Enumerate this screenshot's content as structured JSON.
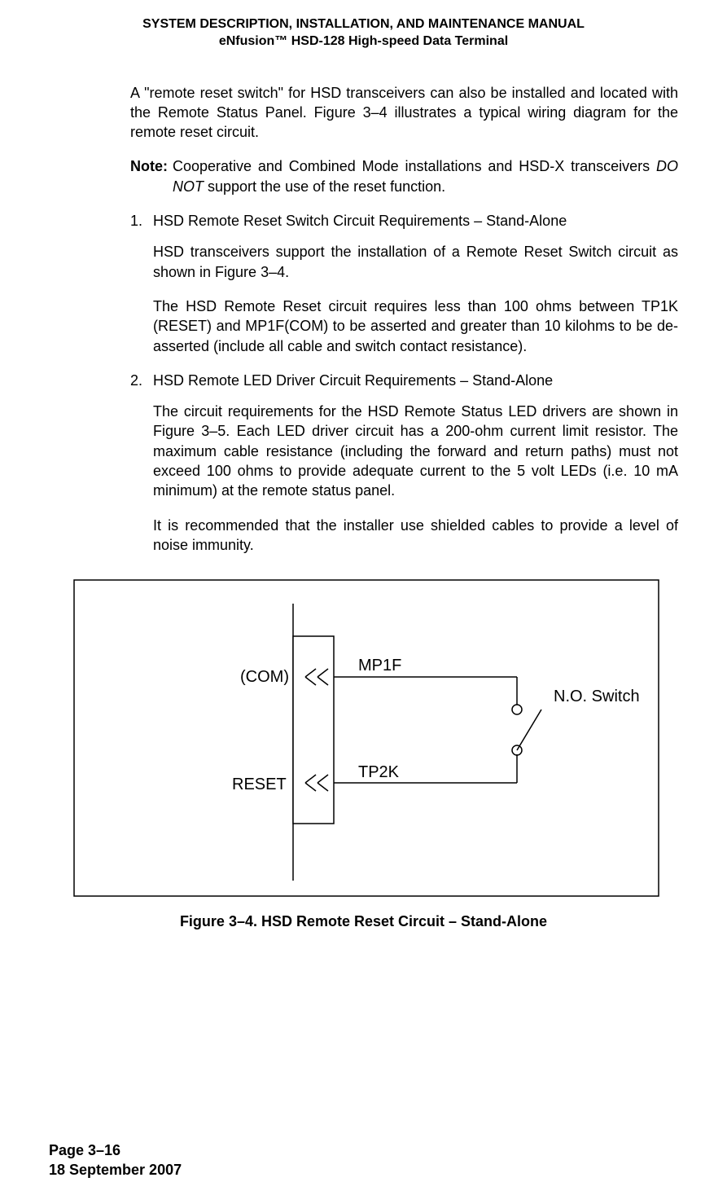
{
  "header": {
    "line1": "SYSTEM DESCRIPTION, INSTALLATION, AND MAINTENANCE MANUAL",
    "line2": "eNfusion™ HSD-128 High-speed Data Terminal"
  },
  "body": {
    "intro": "A \"remote reset switch\" for HSD transceivers can also be installed and located with the Remote Status Panel. Figure 3–4 illustrates a typical wiring diagram for the remote reset circuit.",
    "note_label": "Note:",
    "note_text_before": "Cooperative and Combined Mode installations and HSD-X transceivers ",
    "note_italic": "DO NOT",
    "note_text_after": " support the use of the reset function.",
    "item1_num": "1.",
    "item1_title": "HSD Remote Reset Switch Circuit Requirements – Stand-Alone",
    "item1_p1": "HSD transceivers support the installation of a Remote Reset Switch circuit as shown in Figure 3–4.",
    "item1_p2": "The HSD Remote Reset circuit requires less than 100 ohms between TP1K (RESET) and MP1F(COM) to be asserted and greater than 10 kilohms to be de-asserted (include all cable and switch contact resistance).",
    "item2_num": "2.",
    "item2_title": "HSD Remote LED Driver Circuit Requirements – Stand-Alone",
    "item2_p1": "The circuit requirements for the HSD Remote Status LED drivers are shown in Figure 3–5. Each LED driver circuit has a 200-ohm current limit resistor. The maximum cable resistance (including the forward and return paths) must not exceed 100 ohms to provide adequate current to the 5 volt LEDs (i.e. 10 mA minimum) at the remote status panel.",
    "item2_p2": "It is recommended that the installer use shielded cables to provide a level of noise immunity."
  },
  "figure": {
    "labels": {
      "com": "(COM)",
      "reset": "RESET",
      "mp1f": "MP1F",
      "tp2k": "TP2K",
      "switch": "N.O. Switch"
    },
    "caption": "Figure 3–4. HSD Remote Reset Circuit – Stand-Alone"
  },
  "footer": {
    "page": "Page 3–16",
    "date": "18 September 2007"
  }
}
